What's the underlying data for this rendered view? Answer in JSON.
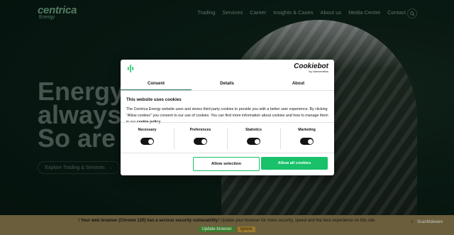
{
  "site": {
    "logo": "centrica",
    "logo_sub": "Energy",
    "nav": [
      "Trading",
      "Services",
      "Career",
      "Insights & Cases",
      "About us",
      "Media Centre",
      "Contact"
    ],
    "hero_lines": [
      "Energy i",
      "always m",
      "So are w"
    ],
    "cta_label": "Explore Trading & Services",
    "cta_arrow": "→"
  },
  "cookie_dialog": {
    "brand_name": "Cookiebot",
    "brand_by": "by Usercentrics",
    "tabs": [
      "Consent",
      "Details",
      "About"
    ],
    "active_tab": "Consent",
    "title": "This website uses cookies",
    "body": "The Centrica Energy website uses and stores third party cookies to provide you with a better user experience. By clicking \"Allow cookies\" you consent to our use of cookies. You can find more information about cookies and how to manage them in our ",
    "link": "cookie policy.",
    "toggles": [
      {
        "label": "Necessary",
        "on": true
      },
      {
        "label": "Preferences",
        "on": true
      },
      {
        "label": "Statistics",
        "on": true
      },
      {
        "label": "Marketing",
        "on": true
      }
    ],
    "btn_selection": "Allow selection",
    "btn_all": "Allow all cookies",
    "accent": "#18c16a"
  },
  "browser_warning": {
    "icon": "!",
    "bold": "Your web browser (Chrome 120) has a serious security vulnerability!",
    "text": " Update your browser for more security, speed and the best experience on this site.",
    "update": "Update browser",
    "ignore": "Ignore",
    "close": "x",
    "scanner": "ScanMalware"
  }
}
